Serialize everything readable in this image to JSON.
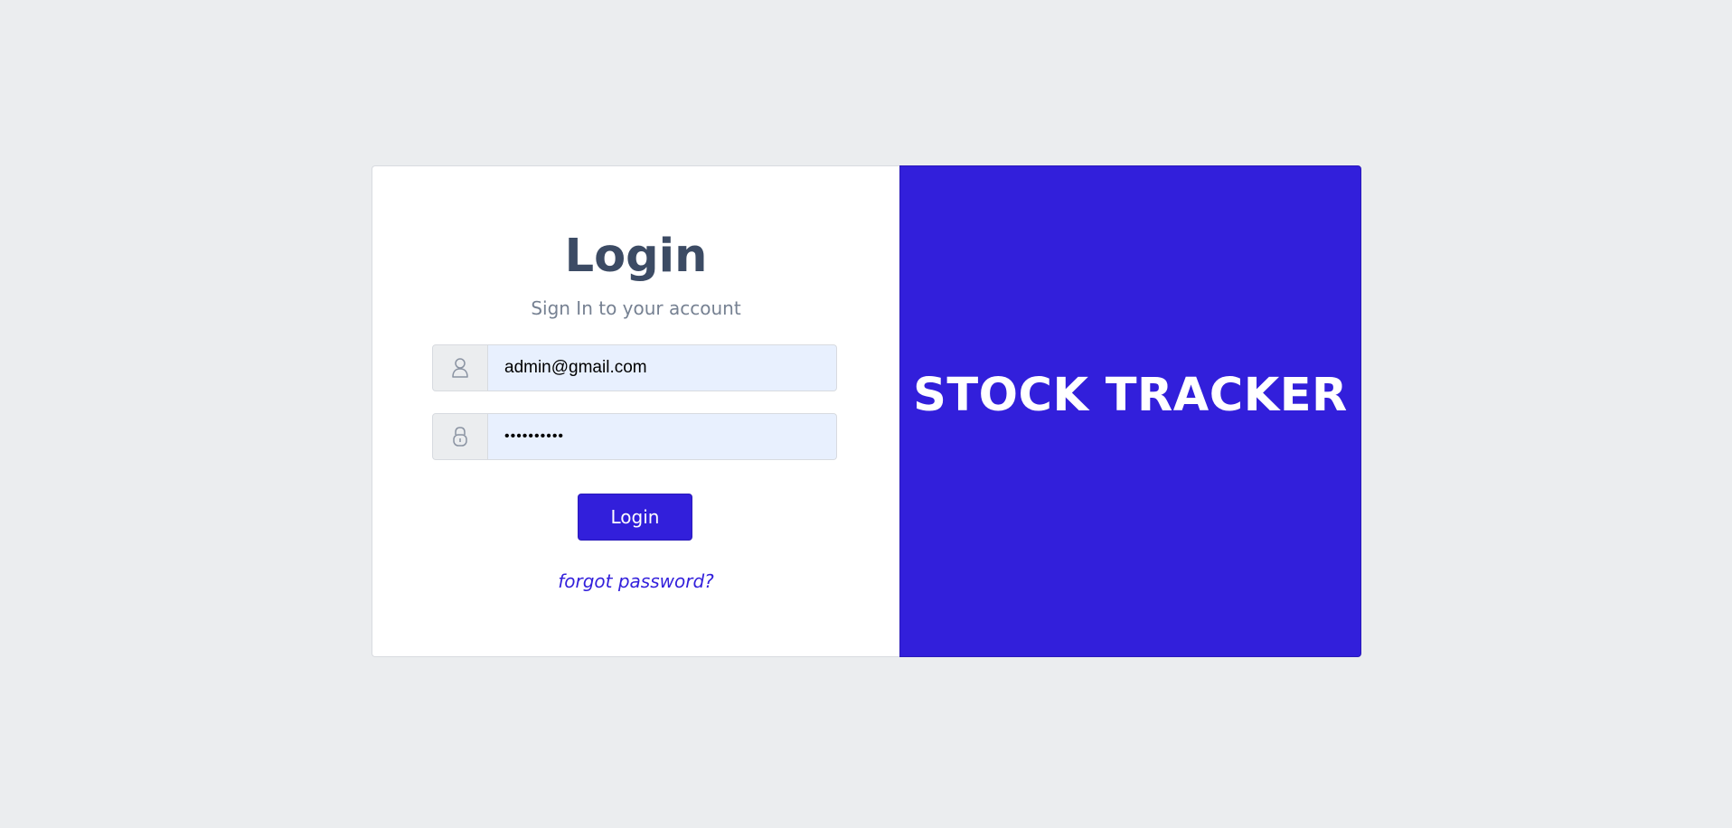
{
  "login": {
    "title": "Login",
    "subtitle": "Sign In to your account",
    "email": {
      "icon": "user-icon",
      "value": "admin@gmail.com"
    },
    "password": {
      "icon": "lock-icon",
      "value": "••••••••••"
    },
    "button_label": "Login",
    "forgot_label": "forgot password?"
  },
  "brand": {
    "title": "STOCK TRACKER"
  },
  "colors": {
    "primary": "#321fdb",
    "background": "#ebedef",
    "title": "#3c4b64",
    "muted": "#768192"
  }
}
